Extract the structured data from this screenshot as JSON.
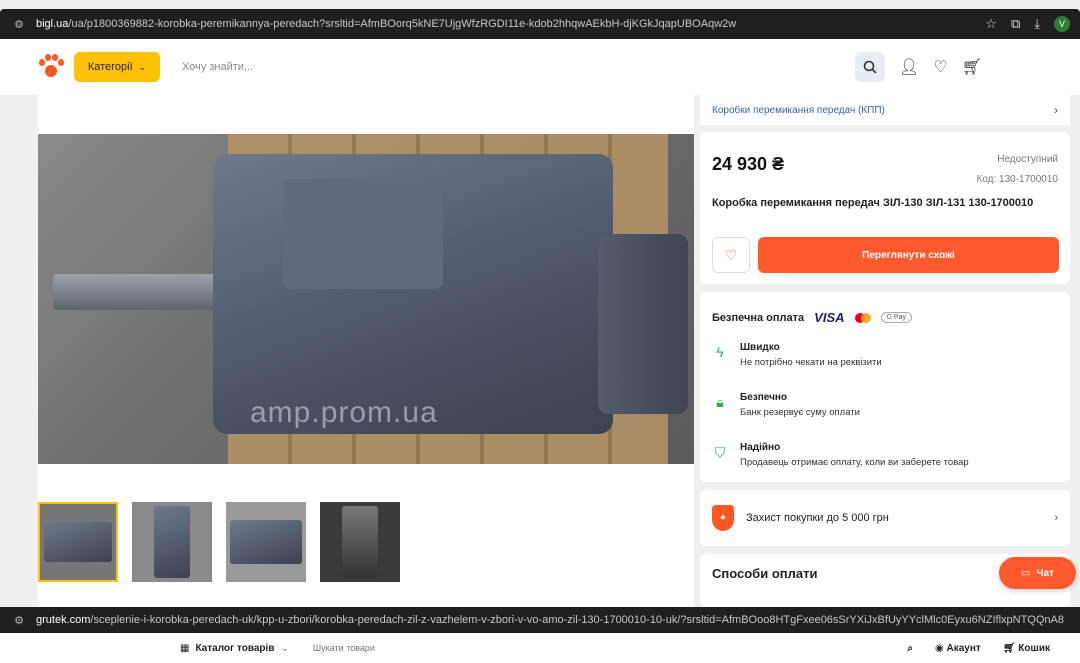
{
  "browser_top": {
    "url_host": "bigl.ua",
    "url_rest": "/ua/p1800369882-korobka-peremikannya-peredach?srsltid=AfmBOorq5kNE7UjgWfzRGDI11e-kdob2hhqwAEkbH-djKGkJqapUBOAqw2w",
    "profile_letter": "V"
  },
  "header": {
    "categories_label": "Категорії",
    "search_placeholder": "Хочу знайти..."
  },
  "gallery": {
    "watermark": "amp.prom.ua"
  },
  "breadcrumb": {
    "label": "Коробки перемикання передач (КПП)"
  },
  "product": {
    "price": "24 930 ₴",
    "availability": "Недоступний",
    "code": "Код: 130-1700010",
    "title": "Коробка перемикання передач ЗІЛ-130 ЗІЛ-131 130-1700010",
    "similar_button": "Переглянути схожі"
  },
  "payment": {
    "heading": "Безпечна оплата",
    "visa": "VISA",
    "gpay": "G Pay",
    "features": [
      {
        "title": "Швидко",
        "desc": "Не потрібно чекати на реквізити",
        "icon": "lightning-icon"
      },
      {
        "title": "Безпечно",
        "desc": "Банк резервує суму оплати",
        "icon": "lock-icon"
      },
      {
        "title": "Надійно",
        "desc": "Продавець отримає оплату, коли ви заберете товар",
        "icon": "shield-check-icon"
      }
    ]
  },
  "protection": {
    "label": "Захист покупки до 5 000 грн"
  },
  "methods": {
    "heading": "Способи оплати"
  },
  "chat": {
    "label": "Чат"
  },
  "browser_bottom": {
    "url_host": "grutek.com",
    "url_rest": "/sceplenie-i-korobka-peredach-uk/kpp-u-zbori/korobka-peredach-zil-z-vazhelem-v-zbori-v-vo-amo-zil-130-1700010-10-uk/?srsltid=AfmBOoo8HTgFxee06sSrYXiJxBfUyYYclMlc0Eyxu6NZIflxpNTQQnA8"
  },
  "bottom_site": {
    "catalog": "Каталог товарів",
    "search": "Шукати товари",
    "account": "Акаунт",
    "cart": "Кошик"
  },
  "colors": {
    "accent": "#ff5a2e",
    "category_button": "#ffc107",
    "success_icon": "#2eae4e",
    "link": "#3a64b4"
  }
}
